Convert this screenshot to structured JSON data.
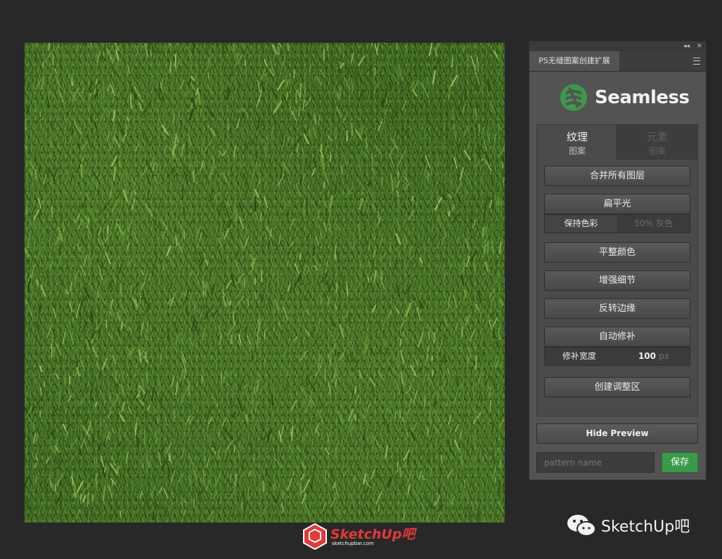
{
  "panel": {
    "title": "PS无缝图案创建扩展",
    "collapse_icon": "double-chevron-left-icon",
    "close_icon": "close-icon",
    "menu_icon": "hamburger-menu-icon",
    "logo_text": "Seamless",
    "logo_color": "#3b9a4a"
  },
  "mode_tabs": [
    {
      "line1": "纹理",
      "line2": "图案",
      "active": true
    },
    {
      "line1": "元素",
      "line2": "图案",
      "active": false
    }
  ],
  "actions": {
    "merge_layers": "合并所有图层",
    "flatten_light": "扁平光",
    "keep_color": "保持色彩",
    "gray_50": "50% 灰色",
    "even_color": "平整颜色",
    "enhance_detail": "增强细节",
    "flip_edges": "反转边缘",
    "auto_patch": "自动修补",
    "patch_width_label": "修补宽度",
    "patch_width_value": "100",
    "patch_width_unit": "px",
    "create_adjust_area": "创建调整区"
  },
  "footer": {
    "hide_preview": "Hide Preview",
    "pattern_name_placeholder": "pattern name",
    "save": "保存"
  },
  "watermarks": {
    "center_brand": "SketchUp吧",
    "center_url": "sketchupbar.com",
    "right_brand": "SketchUp吧"
  }
}
